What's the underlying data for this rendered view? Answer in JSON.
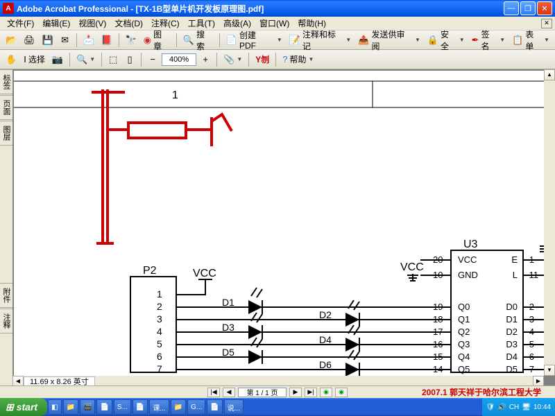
{
  "titlebar": {
    "title": "Adobe Acrobat Professional - [TX-1B型单片机开发板原理图.pdf]"
  },
  "menu": {
    "file": "文件(F)",
    "edit": "编辑(E)",
    "view": "视图(V)",
    "doc": "文档(D)",
    "comment": "注释(C)",
    "tools": "工具(T)",
    "adv": "高级(A)",
    "window": "窗口(W)",
    "help": "帮助(H)"
  },
  "toolbar1": {
    "bookmark": "图章",
    "search": "搜索",
    "createpdf": "创建 PDF",
    "annotate": "注释和标记",
    "sendreview": "发送供审阅",
    "secure": "安全",
    "sign": "签名",
    "form": "表单"
  },
  "toolbar2": {
    "select": "选择",
    "zoom": "400%",
    "yah": "Y刎",
    "help": "帮助"
  },
  "side": {
    "tab1": "标签",
    "tab2": "页面",
    "tab3": "图层",
    "tab4": "附件",
    "tab5": "注释"
  },
  "status": {
    "page_size": "11.69 x 8.26 英寸",
    "page_indicator": "第 1 / 1 页"
  },
  "footer": {
    "credit": "2007.1 郭天祥于哈尔滨工程大学"
  },
  "taskbar": {
    "start": "start",
    "items": [
      "",
      "",
      "",
      "",
      "S...",
      "",
      "课...",
      "",
      "G...",
      "",
      "说..."
    ],
    "tray": {
      "ch": "CH",
      "time": "10:44"
    }
  },
  "schematic": {
    "header_num": "1",
    "p2": {
      "label": "P2",
      "pins": [
        "1",
        "2",
        "3",
        "4",
        "5",
        "6",
        "7"
      ]
    },
    "vcc_left": "VCC",
    "vcc_right": "VCC",
    "diodes_left": [
      "D1",
      "D3",
      "D5"
    ],
    "diodes_right": [
      "D2",
      "D4",
      "D6"
    ],
    "u3": {
      "label": "U3",
      "left_pins": [
        "20",
        "10",
        "19",
        "18",
        "17",
        "16",
        "15",
        "14"
      ],
      "left_labels": [
        "VCC",
        "GND",
        "Q0",
        "Q1",
        "Q2",
        "Q3",
        "Q4",
        "Q5"
      ],
      "right_labels": [
        "E",
        "L",
        "D0",
        "D1",
        "D2",
        "D3",
        "D4",
        "D5"
      ],
      "right_pins": [
        "1",
        "11",
        "2",
        "3",
        "4",
        "5",
        "6",
        "7"
      ]
    }
  }
}
